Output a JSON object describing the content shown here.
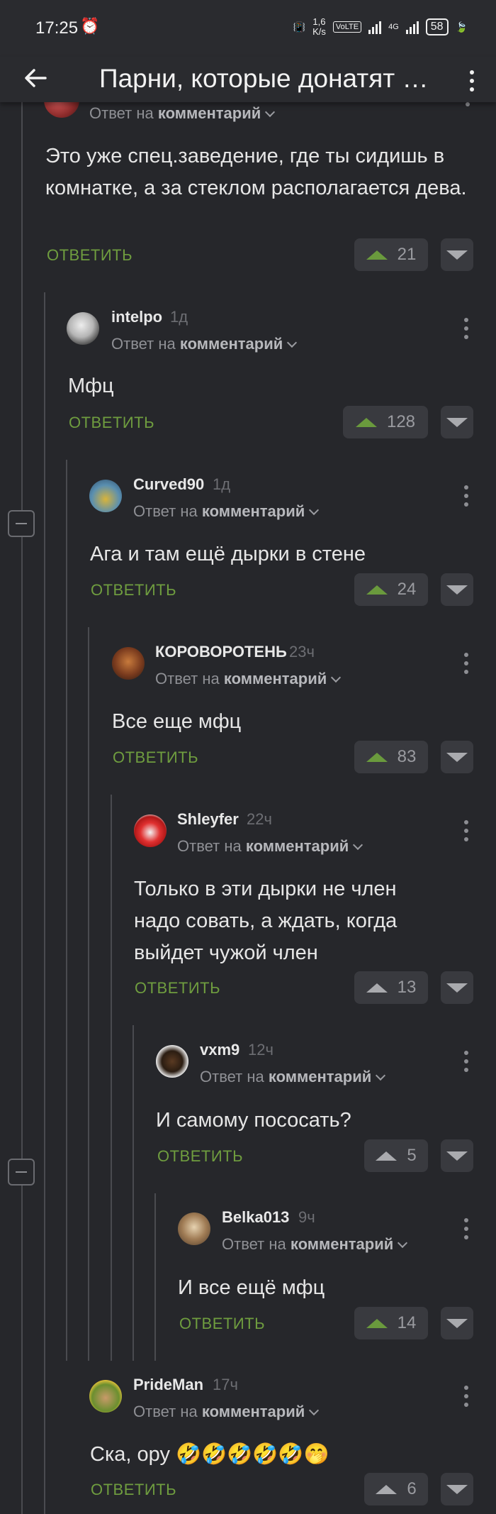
{
  "status_bar": {
    "time": "17:25",
    "speed_top": "1,6",
    "speed_bottom": "K/s",
    "volte": "VoLTE",
    "network": "4G",
    "battery": "58"
  },
  "header": {
    "title": "Парни, которые донатят стримершам"
  },
  "common": {
    "reply_label": "ОТВЕТИТЬ",
    "reply_to_prefix": "Ответ на",
    "reply_to_target": "комментарий"
  },
  "comments": [
    {
      "author": "",
      "age": "",
      "text": "Это уже спец.заведение, где ты сидишь в комнатке, а за стеклом располагается дева.",
      "votes": "21",
      "voted": true
    },
    {
      "author": "intelpo",
      "age": "1д",
      "text": "Мфц",
      "votes": "128",
      "voted": true
    },
    {
      "author": "Curved90",
      "age": "1д",
      "text": "Ага и там ещё дырки в стене",
      "votes": "24",
      "voted": true
    },
    {
      "author": "КОРОВОРОТЕНЬ",
      "age": "23ч",
      "text": "Все еще мфц",
      "votes": "83",
      "voted": true
    },
    {
      "author": "Shleyfer",
      "age": "22ч",
      "text": "Только в эти дырки не член надо совать, а ждать, когда выйдет чужой член",
      "votes": "13",
      "voted": false
    },
    {
      "author": "vxm9",
      "age": "12ч",
      "text": "И самому пососать?",
      "votes": "5",
      "voted": false
    },
    {
      "author": "Belka013",
      "age": "9ч",
      "text": "И все ещё мфц",
      "votes": "14",
      "voted": true
    },
    {
      "author": "PrideMan",
      "age": "17ч",
      "text": "Ска, ору 🤣🤣🤣🤣🤣🤭",
      "votes": "6",
      "voted": false
    }
  ],
  "colors": {
    "background": "#26272b",
    "accent_green": "#6f9d3f",
    "thread_line": "#4a4b50"
  }
}
